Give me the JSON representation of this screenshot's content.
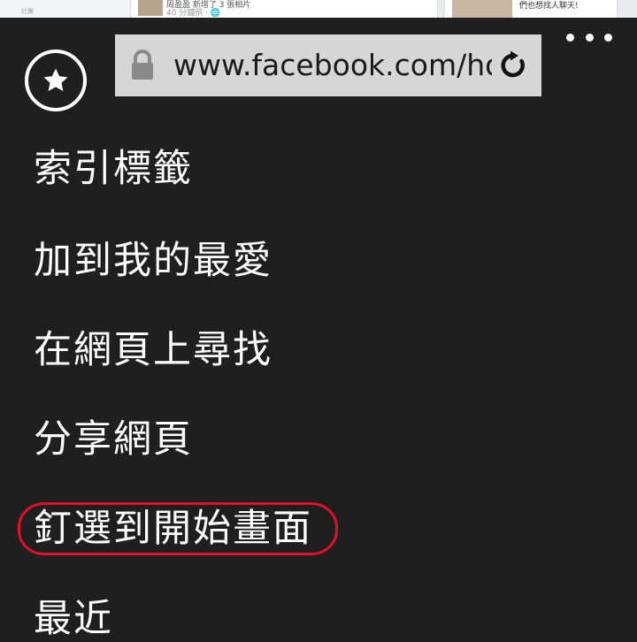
{
  "background_page": {
    "sidebar_label": "社團",
    "post_snippet": "周盈盈 新增了 3 張相片",
    "post_time": "40 分鐘前 · 🌐",
    "side_snippet": "們也想找人聊天!"
  },
  "address_bar": {
    "url": "www.facebook.com/home.php"
  },
  "menu": {
    "items": [
      {
        "label": "索引標籤"
      },
      {
        "label": "加到我的最愛"
      },
      {
        "label": "在網頁上尋找"
      },
      {
        "label": "分享網頁"
      },
      {
        "label": "釘選到開始畫面"
      },
      {
        "label": "最近"
      }
    ]
  },
  "colors": {
    "panel_background": "#1f1f1f",
    "menu_text": "#ffffff",
    "address_bar_background": "#d6d6d6",
    "highlight_ring": "#e0112b"
  },
  "icons": {
    "favorites": "star-icon",
    "lock": "lock-icon",
    "refresh": "refresh-icon",
    "more": "more-icon"
  }
}
